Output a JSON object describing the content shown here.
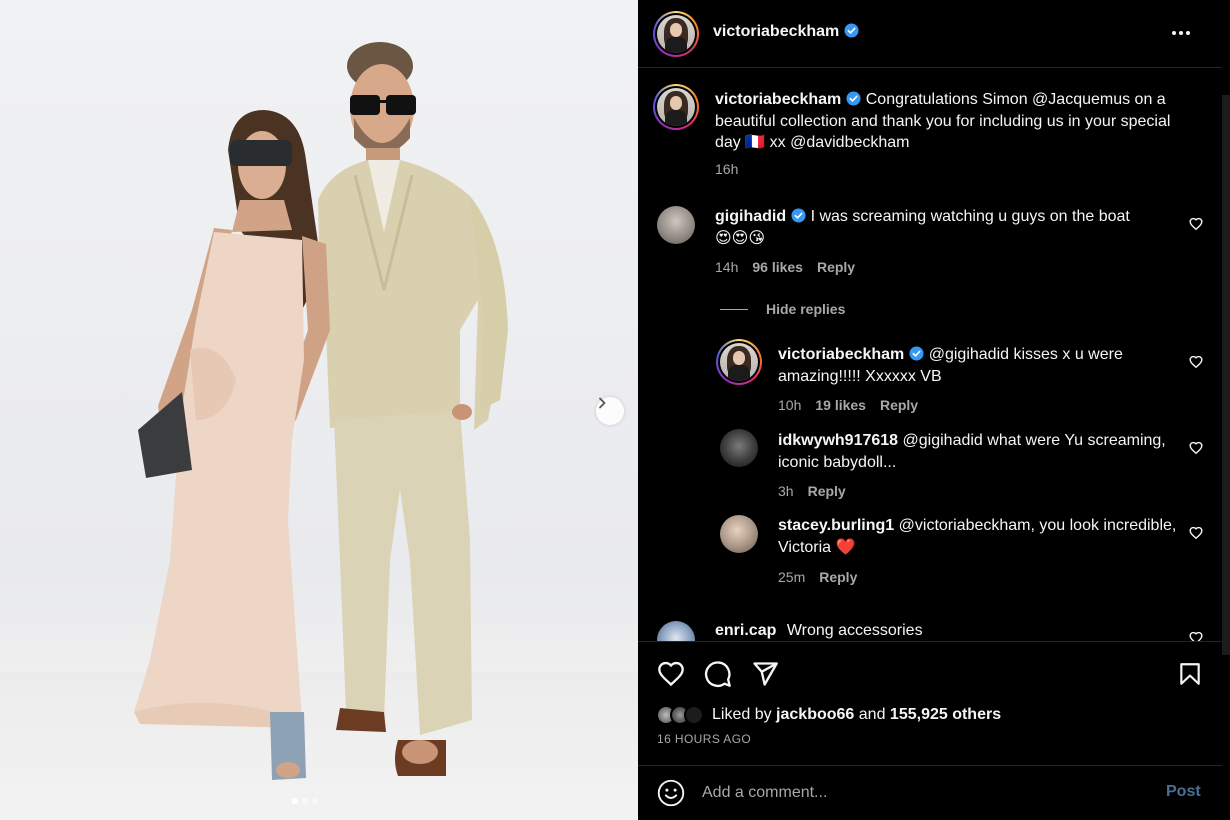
{
  "post": {
    "author": "victoriabeckham",
    "caption_user": "victoriabeckham",
    "caption_text": "Congratulations Simon @Jacquemus on a beautiful collection and thank you for including us in your special day",
    "caption_flag": "🇫🇷",
    "caption_tail": "xx @davidbeckham",
    "caption_time": "16h"
  },
  "comments": [
    {
      "user": "gigihadid",
      "text": "I was screaming watching u guys on the boat",
      "emojis": "😍😍😘",
      "time": "14h",
      "likes": "96 likes",
      "reply": "Reply"
    }
  ],
  "hide_replies": "Hide replies",
  "replies": [
    {
      "user": "victoriabeckham",
      "text": "@gigihadid kisses x u were amazing!!!!! Xxxxxx VB",
      "time": "10h",
      "likes": "19 likes",
      "reply": "Reply"
    },
    {
      "user": "idkwywh917618",
      "text": "@gigihadid what were Yu screaming, iconic babydoll...",
      "time": "3h",
      "reply": "Reply"
    },
    {
      "user": "stacey.burling1",
      "text": "@victoriabeckham, you look incredible, Victoria",
      "heart": "❤️",
      "time": "25m",
      "reply": "Reply"
    }
  ],
  "partial_comment": {
    "user": "enri.cap",
    "text": "Wrong accessories"
  },
  "likes": {
    "prefix": "Liked by",
    "user": "jackboo66",
    "joiner": "and",
    "others": "155,925 others"
  },
  "time_ago": "16 HOURS AGO",
  "composer": {
    "placeholder": "Add a comment...",
    "post_label": "Post"
  },
  "icons": {
    "more": "more-horizontal-icon",
    "like": "heart-icon",
    "comment": "comment-icon",
    "share": "send-icon",
    "save": "bookmark-icon",
    "emoji": "emoji-icon",
    "next": "chevron-right-icon",
    "verified": "verified-badge-icon"
  },
  "colors": {
    "verified": "#3897f0",
    "post_button": "#4a6f95",
    "muted": "#a8a8a8"
  },
  "carousel": {
    "count": 3,
    "active": 1
  }
}
